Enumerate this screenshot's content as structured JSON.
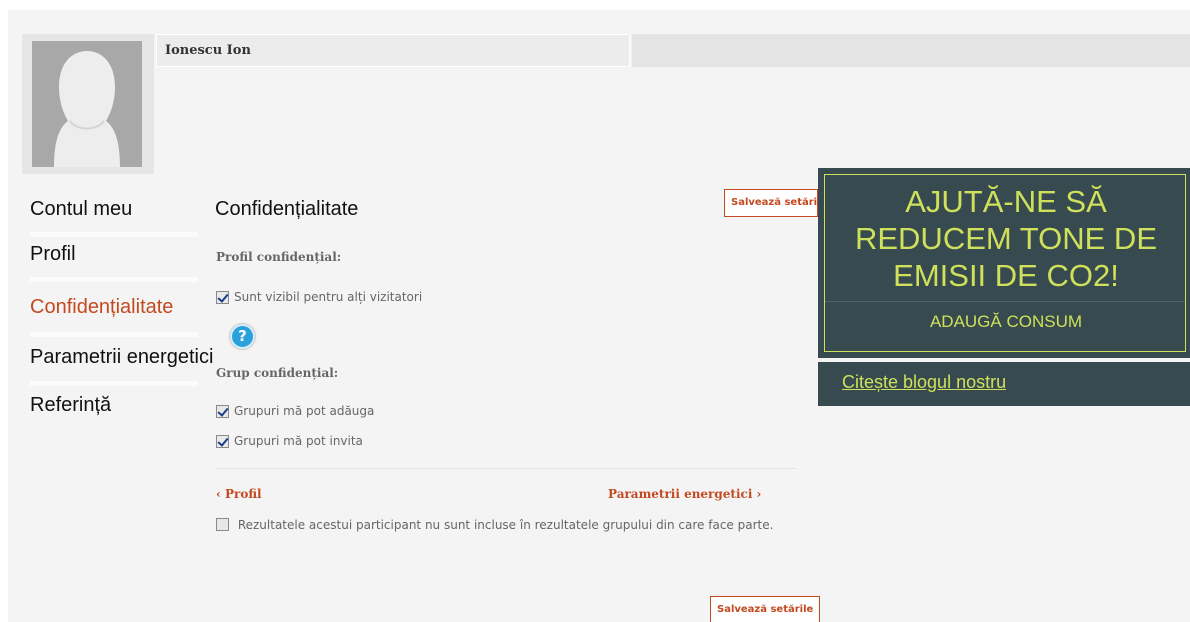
{
  "user": {
    "name": "Ionescu Ion"
  },
  "nav": {
    "items": [
      {
        "label": "Contul meu"
      },
      {
        "label": "Profil"
      },
      {
        "label": "Confidențialitate"
      },
      {
        "label": "Parametrii energetici"
      },
      {
        "label": "Referință"
      }
    ],
    "active_index": 2
  },
  "main": {
    "title": "Confidențialitate",
    "save_label": "Salvează setările",
    "profile_section": {
      "heading": "Profil confidențial:",
      "options": [
        {
          "label": "Sunt vizibil pentru alți vizitatori",
          "checked": true
        }
      ]
    },
    "help_icon": "question-mark-icon",
    "group_section": {
      "heading": "Grup confidențial:",
      "options": [
        {
          "label": "Grupuri mă pot adăuga",
          "checked": true
        },
        {
          "label": "Grupuri mă pot invita",
          "checked": true
        }
      ]
    },
    "prev_link": "‹ Profil",
    "next_link": "Parametrii energetici ›",
    "exclusion_note": {
      "label": "Rezultatele acestui participant nu sunt incluse în rezultatele grupului din care face parte.",
      "checked": false
    }
  },
  "promo": {
    "title": "AJUTĂ-NE SĂ REDUCEM TONE DE EMISII DE CO2!",
    "action": "ADAUGĂ CONSUM",
    "blog_link": "Citește blogul nostru"
  },
  "colors": {
    "accent": "#c34a20",
    "promo_bg": "#364a4f",
    "promo_text": "#cfe05a",
    "help_icon": "#2aa0dd"
  }
}
